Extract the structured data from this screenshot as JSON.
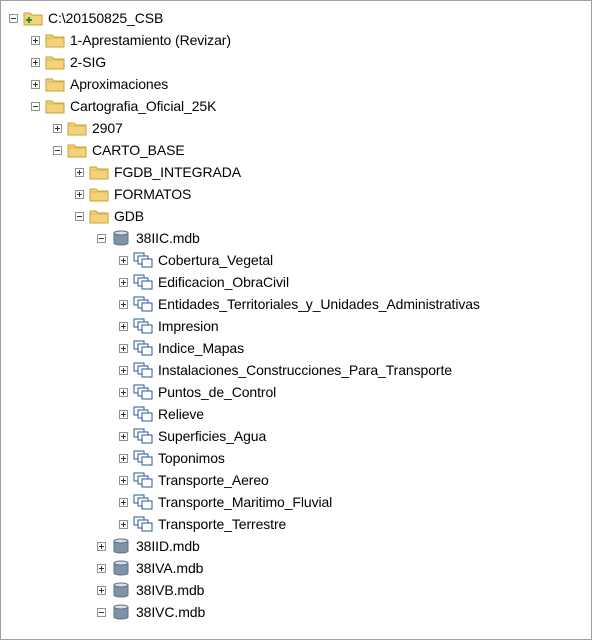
{
  "tree": {
    "nodes": [
      {
        "label": "C:\\20150825_CSB",
        "icon": "folder-connection-icon",
        "expanded": true
      },
      {
        "label": "1-Aprestamiento (Revizar)",
        "icon": "folder-icon",
        "expanded": false
      },
      {
        "label": "2-SIG",
        "icon": "folder-icon",
        "expanded": false
      },
      {
        "label": "Aproximaciones",
        "icon": "folder-icon",
        "expanded": false
      },
      {
        "label": "Cartografia_Oficial_25K",
        "icon": "folder-icon",
        "expanded": true
      },
      {
        "label": "2907",
        "icon": "folder-icon",
        "expanded": false
      },
      {
        "label": "CARTO_BASE",
        "icon": "folder-icon",
        "expanded": true
      },
      {
        "label": "FGDB_INTEGRADA",
        "icon": "folder-icon",
        "expanded": false
      },
      {
        "label": "FORMATOS",
        "icon": "folder-icon",
        "expanded": false
      },
      {
        "label": "GDB",
        "icon": "folder-icon",
        "expanded": true
      },
      {
        "label": "38IIC.mdb",
        "icon": "geodatabase-icon",
        "expanded": true
      },
      {
        "label": "Cobertura_Vegetal",
        "icon": "feature-dataset-icon",
        "expanded": false
      },
      {
        "label": "Edificacion_ObraCivil",
        "icon": "feature-dataset-icon",
        "expanded": false
      },
      {
        "label": "Entidades_Territoriales_y_Unidades_Administrativas",
        "icon": "feature-dataset-icon",
        "expanded": false
      },
      {
        "label": "Impresion",
        "icon": "feature-dataset-icon",
        "expanded": false
      },
      {
        "label": "Indice_Mapas",
        "icon": "feature-dataset-icon",
        "expanded": false
      },
      {
        "label": "Instalaciones_Construcciones_Para_Transporte",
        "icon": "feature-dataset-icon",
        "expanded": false
      },
      {
        "label": "Puntos_de_Control",
        "icon": "feature-dataset-icon",
        "expanded": false
      },
      {
        "label": "Relieve",
        "icon": "feature-dataset-icon",
        "expanded": false
      },
      {
        "label": "Superficies_Agua",
        "icon": "feature-dataset-icon",
        "expanded": false
      },
      {
        "label": "Toponimos",
        "icon": "feature-dataset-icon",
        "expanded": false
      },
      {
        "label": "Transporte_Aereo",
        "icon": "feature-dataset-icon",
        "expanded": false
      },
      {
        "label": "Transporte_Maritimo_Fluvial",
        "icon": "feature-dataset-icon",
        "expanded": false
      },
      {
        "label": "Transporte_Terrestre",
        "icon": "feature-dataset-icon",
        "expanded": false
      },
      {
        "label": "38IID.mdb",
        "icon": "geodatabase-icon",
        "expanded": false
      },
      {
        "label": "38IVA.mdb",
        "icon": "geodatabase-icon",
        "expanded": false
      },
      {
        "label": "38IVB.mdb",
        "icon": "geodatabase-icon",
        "expanded": false
      },
      {
        "label": "38IVC.mdb",
        "icon": "geodatabase-icon",
        "expanded": true
      }
    ]
  },
  "colors": {
    "folder": "#f3d37a",
    "folder_border": "#c9a13b",
    "connection": "#2f8f2f",
    "database": "#7f93a8",
    "dataset_outline": "#2b5797"
  }
}
